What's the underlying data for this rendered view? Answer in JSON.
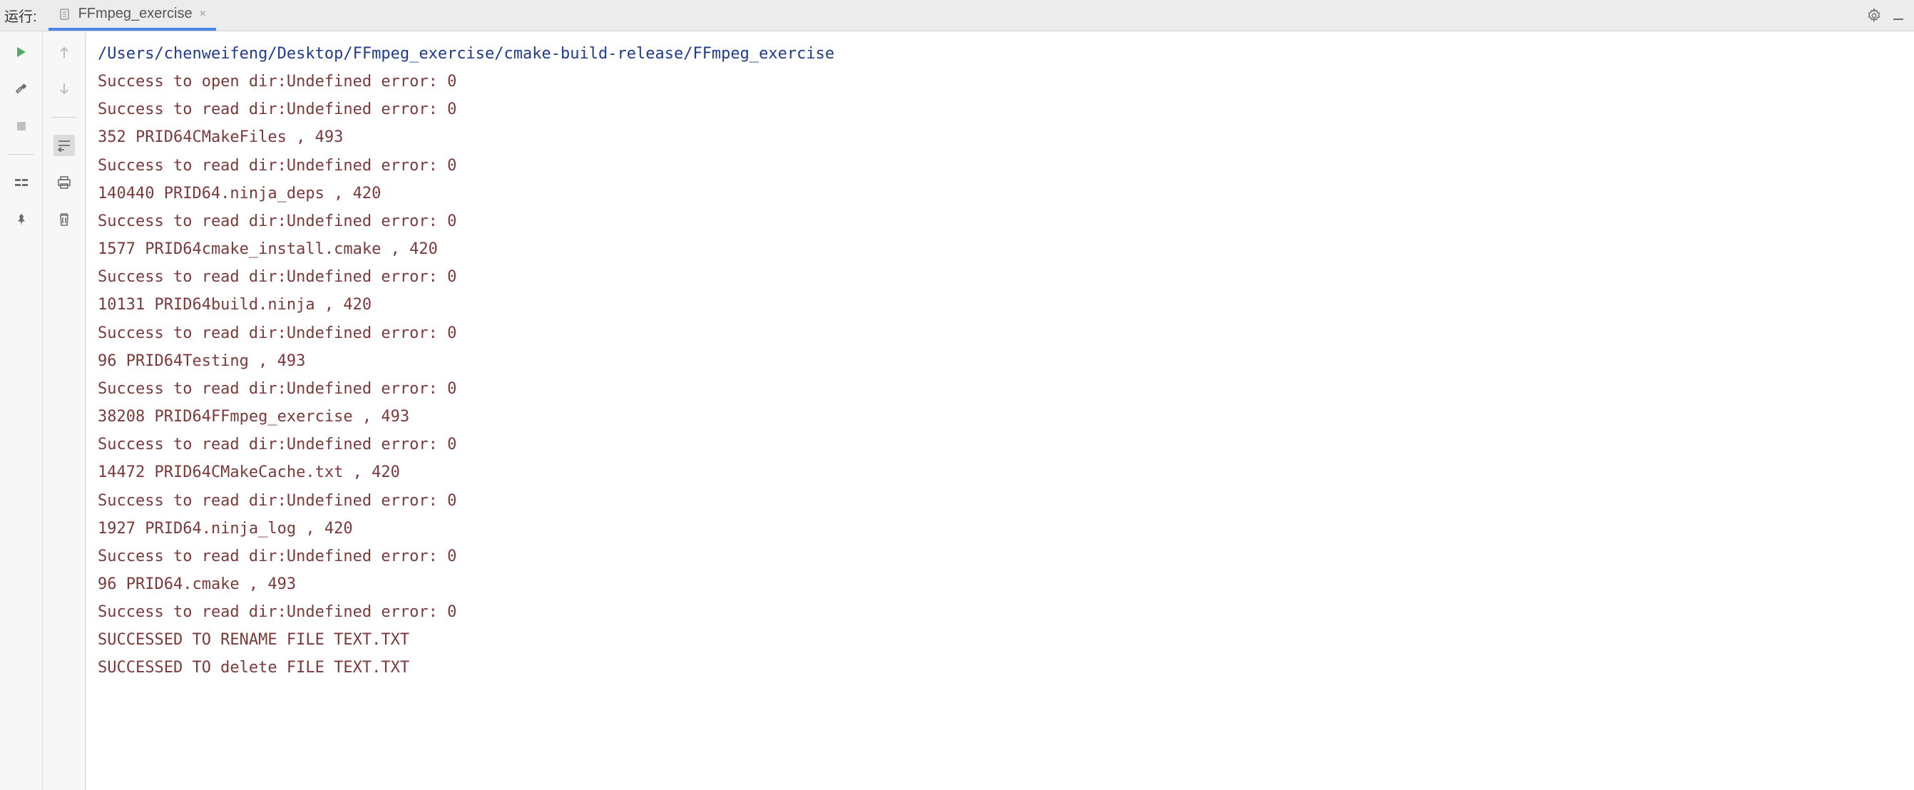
{
  "header": {
    "run_label": "运行:",
    "tab_label": "FFmpeg_exercise",
    "tab_close": "×"
  },
  "console": {
    "path": "/Users/chenweifeng/Desktop/FFmpeg_exercise/cmake-build-release/FFmpeg_exercise",
    "lines": [
      "Success to open dir:Undefined error: 0",
      "Success to read dir:Undefined error: 0",
      "352 PRID64CMakeFiles , 493",
      "Success to read dir:Undefined error: 0",
      "140440 PRID64.ninja_deps , 420",
      "Success to read dir:Undefined error: 0",
      "1577 PRID64cmake_install.cmake , 420",
      "Success to read dir:Undefined error: 0",
      "10131 PRID64build.ninja , 420",
      "Success to read dir:Undefined error: 0",
      "96 PRID64Testing , 493",
      "Success to read dir:Undefined error: 0",
      "38208 PRID64FFmpeg_exercise , 493",
      "Success to read dir:Undefined error: 0",
      "14472 PRID64CMakeCache.txt , 420",
      "Success to read dir:Undefined error: 0",
      "1927 PRID64.ninja_log , 420",
      "Success to read dir:Undefined error: 0",
      "96 PRID64.cmake , 493",
      "Success to read dir:Undefined error: 0",
      "SUCCESSED TO RENAME FILE TEXT.TXT",
      "SUCCESSED TO delete FILE TEXT.TXT"
    ]
  },
  "icons": {
    "gear": "gear-icon",
    "minimize": "minimize-icon",
    "play": "play-icon",
    "wrench": "wrench-icon",
    "stop": "stop-icon",
    "layout": "layout-icon",
    "pin": "pin-icon",
    "arrow_up": "arrow-up-icon",
    "arrow_down": "arrow-down-icon",
    "scroll_end": "scroll-to-end-icon",
    "print": "print-icon",
    "trash": "trash-icon",
    "file": "file-icon"
  }
}
